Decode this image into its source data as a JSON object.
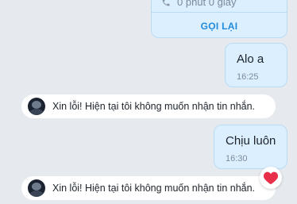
{
  "call_card": {
    "duration": "0 phút 0 giây",
    "callback_label": "GỌI LẠI"
  },
  "messages": [
    {
      "text": "Alo a",
      "time": "16:25"
    },
    {
      "text": "Chịu luôn",
      "time": "16:30"
    }
  ],
  "notices": [
    {
      "text": "Xin lỗi! Hiện tại tôi không muốn nhận tin nhắn."
    },
    {
      "text": "Xin lỗi! Hiện tại tôi không muốn nhận tin nhắn."
    }
  ],
  "reaction": {
    "icon": "heart-icon",
    "color": "#e8304a"
  },
  "colors": {
    "background": "#e6eaef",
    "bubble": "#dcefff",
    "accent": "#1f8bdc"
  }
}
